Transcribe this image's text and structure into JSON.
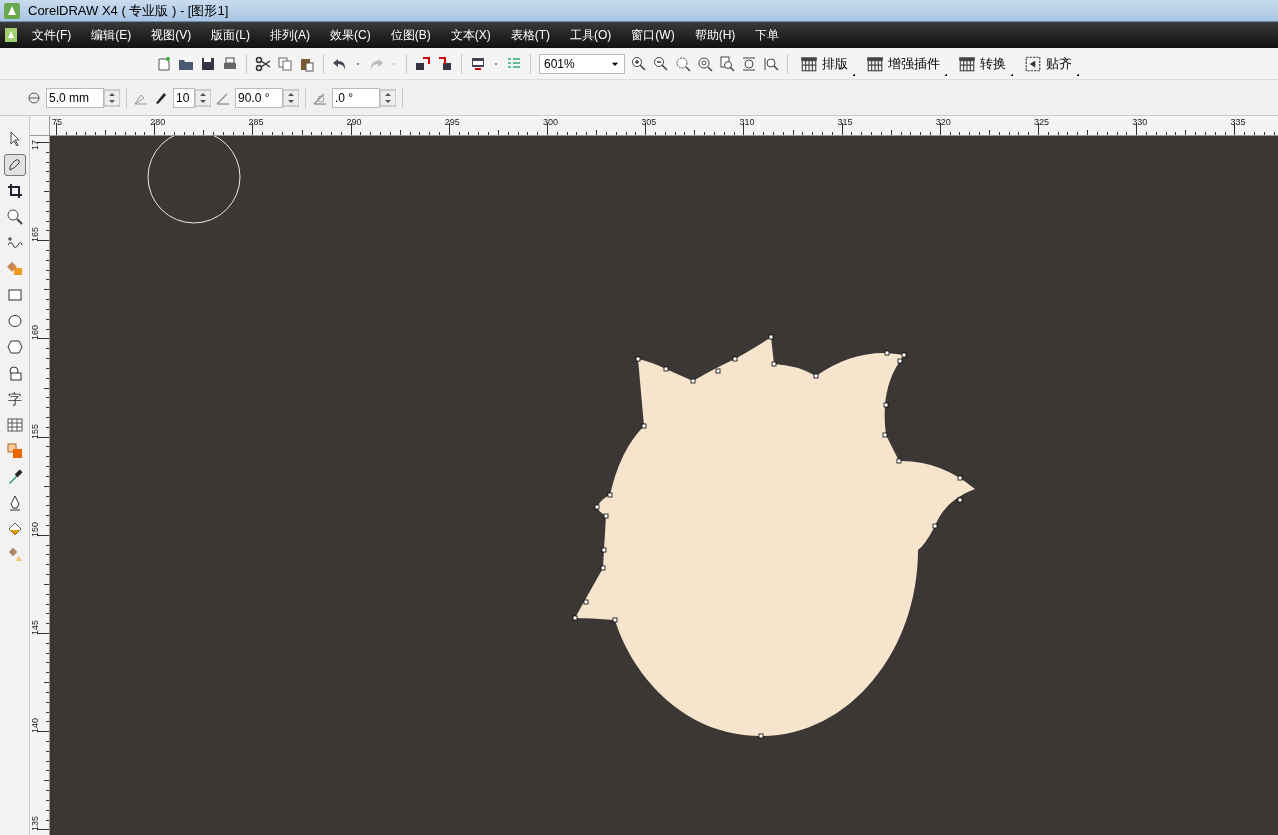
{
  "window": {
    "title": "CorelDRAW X4 ( 专业版 ) - [图形1]"
  },
  "menu": [
    "文件(F)",
    "编辑(E)",
    "视图(V)",
    "版面(L)",
    "排列(A)",
    "效果(C)",
    "位图(B)",
    "文本(X)",
    "表格(T)",
    "工具(O)",
    "窗口(W)",
    "帮助(H)",
    "下单"
  ],
  "toolbar": {
    "zoom": "601%",
    "plugin_buttons": [
      "排版",
      "增强插件",
      "转换",
      "贴齐"
    ]
  },
  "property_bar": {
    "fields": [
      {
        "value": "5.0 mm"
      },
      {
        "value": "10"
      },
      {
        "value": "90.0 °"
      },
      {
        "value": ".0 °"
      }
    ]
  },
  "toolbox": [
    {
      "selected": false
    },
    {
      "selected": true
    },
    {
      "selected": false
    },
    {
      "selected": false
    },
    {
      "selected": false
    },
    {
      "selected": false
    },
    {
      "selected": false
    },
    {
      "selected": false
    },
    {
      "selected": false
    },
    {
      "selected": false
    },
    {
      "selected": false,
      "glyph": "字"
    },
    {
      "selected": false
    },
    {
      "selected": false
    },
    {
      "selected": false
    },
    {
      "selected": false
    },
    {
      "selected": false
    },
    {
      "selected": false
    }
  ],
  "rulers": {
    "horizontal": [
      "75",
      "280",
      "285",
      "290",
      "295",
      "300",
      "305",
      "310",
      "315",
      "320",
      "325",
      "330",
      "335"
    ],
    "vertical": [
      "17",
      "165",
      "160",
      "155",
      "150",
      "145",
      "140",
      "135"
    ]
  }
}
